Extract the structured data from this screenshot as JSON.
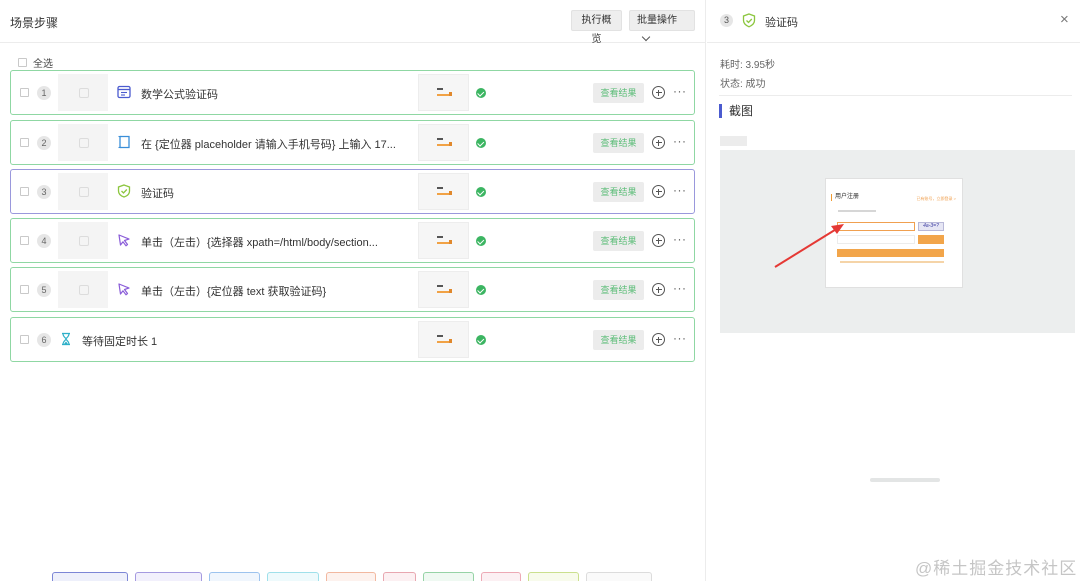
{
  "header": {
    "title": "场景步骤",
    "overview_label": "执行概览",
    "batch_label": "批量操作"
  },
  "select_all_label": "全选",
  "steps": [
    {
      "num": "1",
      "label": "数学公式验证码",
      "icon": "formula-window-icon",
      "result_label": "查看结果",
      "status": "success"
    },
    {
      "num": "2",
      "label": "在 {定位器 placeholder 请输入手机号码} 上输入 17...",
      "icon": "input-box-icon",
      "result_label": "查看结果",
      "status": "success"
    },
    {
      "num": "3",
      "label": "验证码",
      "icon": "shield-check-icon",
      "result_label": "查看结果",
      "status": "success"
    },
    {
      "num": "4",
      "label": "单击（左击）{选择器   xpath=/html/body/section...",
      "icon": "click-pointer-icon",
      "result_label": "查看结果",
      "status": "success"
    },
    {
      "num": "5",
      "label": "单击（左击）{定位器  text  获取验证码}",
      "icon": "click-pointer-icon",
      "result_label": "查看结果",
      "status": "success"
    },
    {
      "num": "6",
      "label": "等待固定时长 1",
      "icon": "hourglass-icon",
      "result_label": "查看结果",
      "status": "success"
    }
  ],
  "detail": {
    "num": "3",
    "title": "验证码",
    "time_text": "耗时: 3.95秒",
    "status_text": "状态: 成功",
    "screenshot_heading": "截图",
    "mock_form": {
      "title": "用户注册",
      "login_link": "已有账号，立即登录 >",
      "captcha_text": "4a-3=?"
    }
  },
  "watermark": "@稀土掘金技术社区",
  "colors": {
    "success_border": "#8fd7a3",
    "active_border": "#9a98dc",
    "success_green": "#3cb562",
    "accent_blue": "#4b5bcf",
    "arrow_red": "#e53935",
    "form_orange": "#f2a54a"
  }
}
